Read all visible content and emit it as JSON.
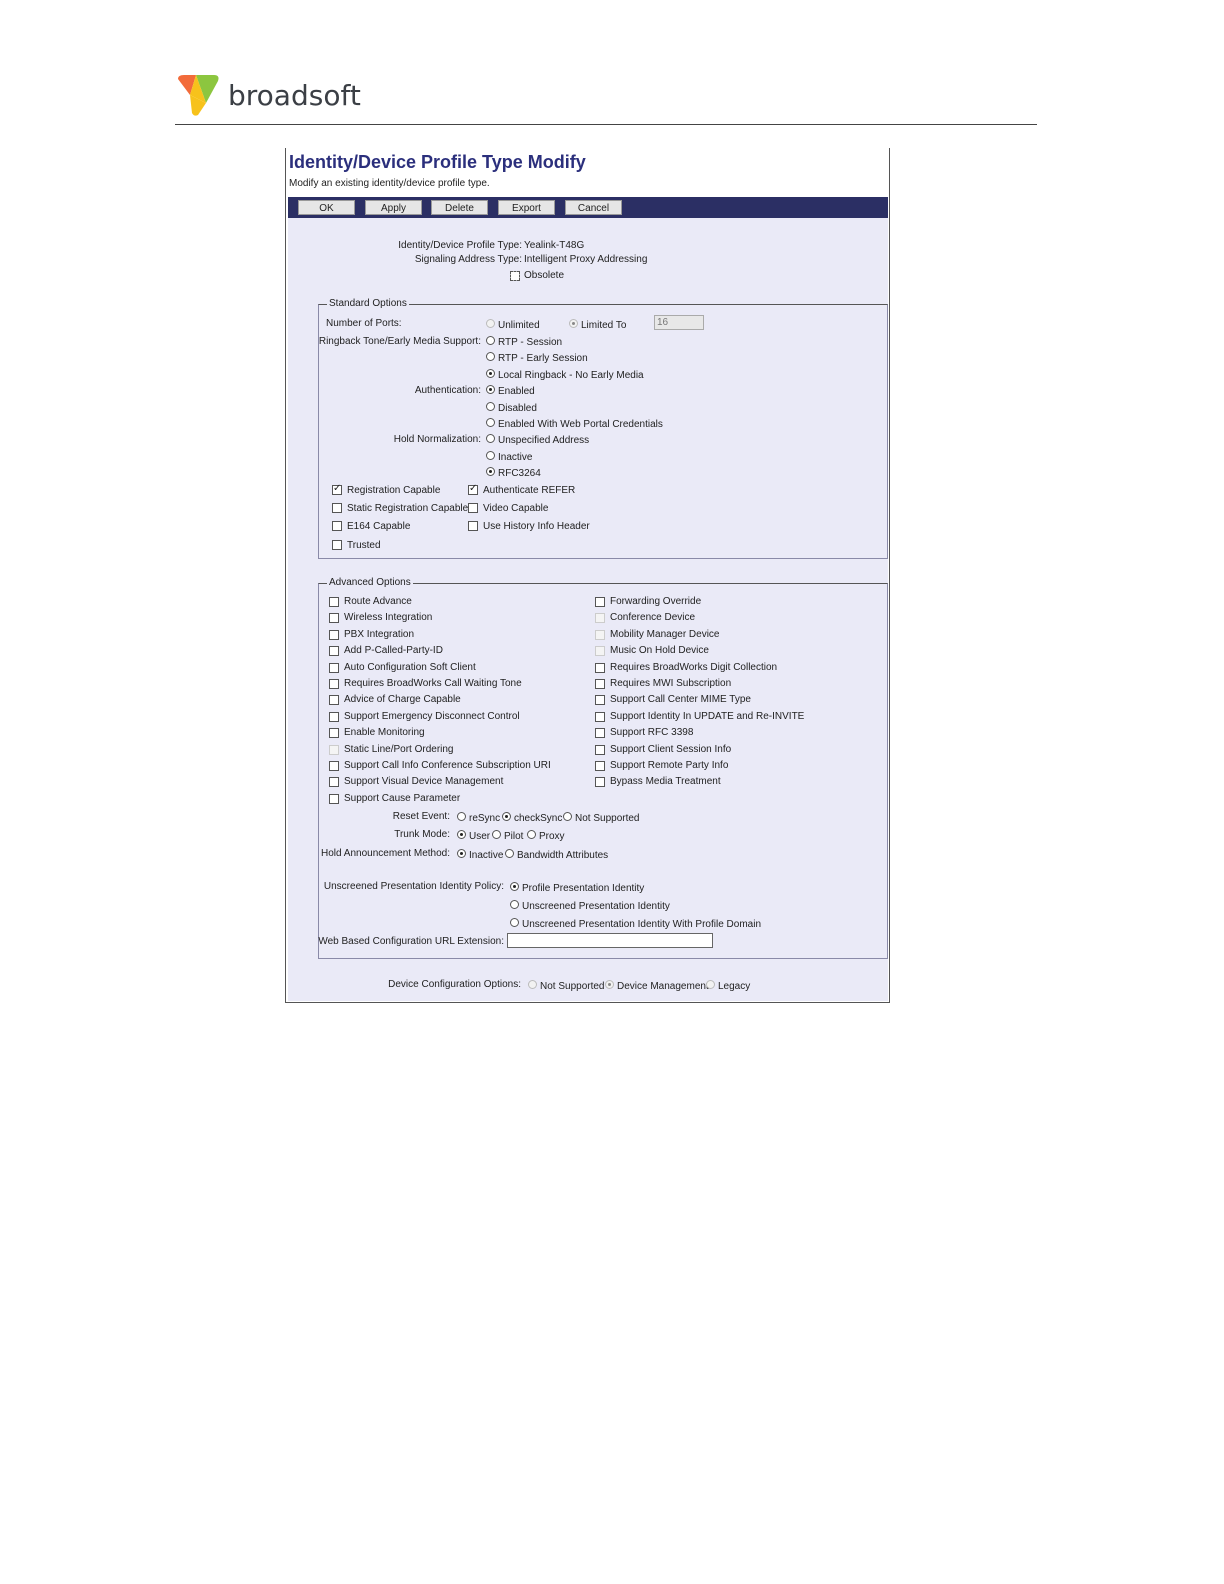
{
  "header": {
    "brand": "broadsoft"
  },
  "page": {
    "title": "Identity/Device Profile Type Modify",
    "subtitle": "Modify an existing identity/device profile type."
  },
  "toolbar": {
    "ok": "OK",
    "apply": "Apply",
    "delete": "Delete",
    "export": "Export",
    "cancel": "Cancel"
  },
  "info": {
    "profile_type_label": "Identity/Device Profile Type:",
    "profile_type_value": "Yealink-T48G",
    "signaling_label": "Signaling Address Type:",
    "signaling_value": "Intelligent Proxy Addressing",
    "obsolete": "Obsolete"
  },
  "standard": {
    "legend": "Standard Options",
    "ports_label": "Number of Ports:",
    "unlimited": "Unlimited",
    "limited_to": "Limited To",
    "ports_value": "16",
    "ringback_label": "Ringback Tone/Early Media Support:",
    "rtp_session": "RTP - Session",
    "rtp_early": "RTP - Early Session",
    "local_ringback": "Local Ringback - No Early Media",
    "auth_label": "Authentication:",
    "auth_enabled": "Enabled",
    "auth_disabled": "Disabled",
    "auth_web": "Enabled With Web Portal Credentials",
    "hold_label": "Hold Normalization:",
    "hold_unspecified": "Unspecified Address",
    "hold_inactive": "Inactive",
    "hold_rfc": "RFC3264",
    "registration_capable": "Registration Capable",
    "authenticate_refer": "Authenticate REFER",
    "static_registration": "Static Registration Capable",
    "video_capable": "Video Capable",
    "e164_capable": "E164 Capable",
    "history_info": "Use History Info Header",
    "trusted": "Trusted"
  },
  "advanced": {
    "legend": "Advanced Options",
    "left": [
      "Route Advance",
      "Wireless Integration",
      "PBX Integration",
      "Add P-Called-Party-ID",
      "Auto Configuration Soft Client",
      "Requires BroadWorks Call Waiting Tone",
      "Advice of Charge Capable",
      "Support Emergency Disconnect Control",
      "Enable Monitoring",
      "Static Line/Port Ordering",
      "Support Call Info Conference Subscription URI",
      "Support Visual Device Management",
      "Support Cause Parameter"
    ],
    "right": [
      "Forwarding Override",
      "Conference Device",
      "Mobility Manager Device",
      "Music On Hold Device",
      "Requires BroadWorks Digit Collection",
      "Requires MWI Subscription",
      "Support Call Center MIME Type",
      "Support Identity In UPDATE and Re-INVITE",
      "Support RFC 3398",
      "Support Client Session Info",
      "Support Remote Party Info",
      "Bypass Media Treatment"
    ],
    "reset_label": "Reset Event:",
    "resync": "reSync",
    "checksync": "checkSync",
    "not_supported": "Not Supported",
    "trunk_label": "Trunk Mode:",
    "user": "User",
    "pilot": "Pilot",
    "proxy": "Proxy",
    "hold_ann_label": "Hold Announcement Method:",
    "inactive": "Inactive",
    "bandwidth": "Bandwidth Attributes",
    "unscreened_label": "Unscreened Presentation Identity Policy:",
    "profile_pi": "Profile Presentation Identity",
    "unscreened_pi": "Unscreened Presentation Identity",
    "unscreened_pi_domain": "Unscreened Presentation Identity With Profile Domain",
    "web_url_label": "Web Based Configuration URL Extension:"
  },
  "device_config": {
    "label": "Device Configuration Options:",
    "not_supported": "Not Supported",
    "device_management": "Device Management",
    "legacy": "Legacy"
  }
}
